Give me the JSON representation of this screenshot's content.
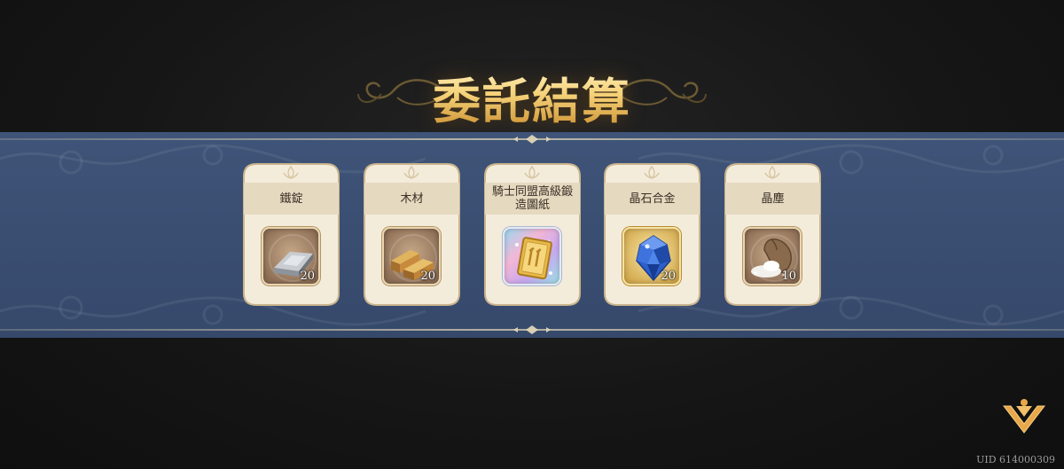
{
  "title": "委託結算",
  "rewards": [
    {
      "name": "鐵錠",
      "qty": "20",
      "icon": "iron-ingot-icon"
    },
    {
      "name": "木材",
      "qty": "20",
      "icon": "wood-icon"
    },
    {
      "name": "騎士同盟高級鍛造圖紙",
      "qty": "",
      "icon": "blueprint-book-icon"
    },
    {
      "name": "晶石合金",
      "qty": "20",
      "icon": "blue-crystal-icon"
    },
    {
      "name": "晶塵",
      "qty": "10",
      "icon": "dust-sack-icon"
    }
  ],
  "uid": "UID 614000309",
  "colors": {
    "banner": "#3c5074",
    "card": "#f3ead8",
    "title_gold": "#f4d48a",
    "accent": "#e8a84a"
  }
}
